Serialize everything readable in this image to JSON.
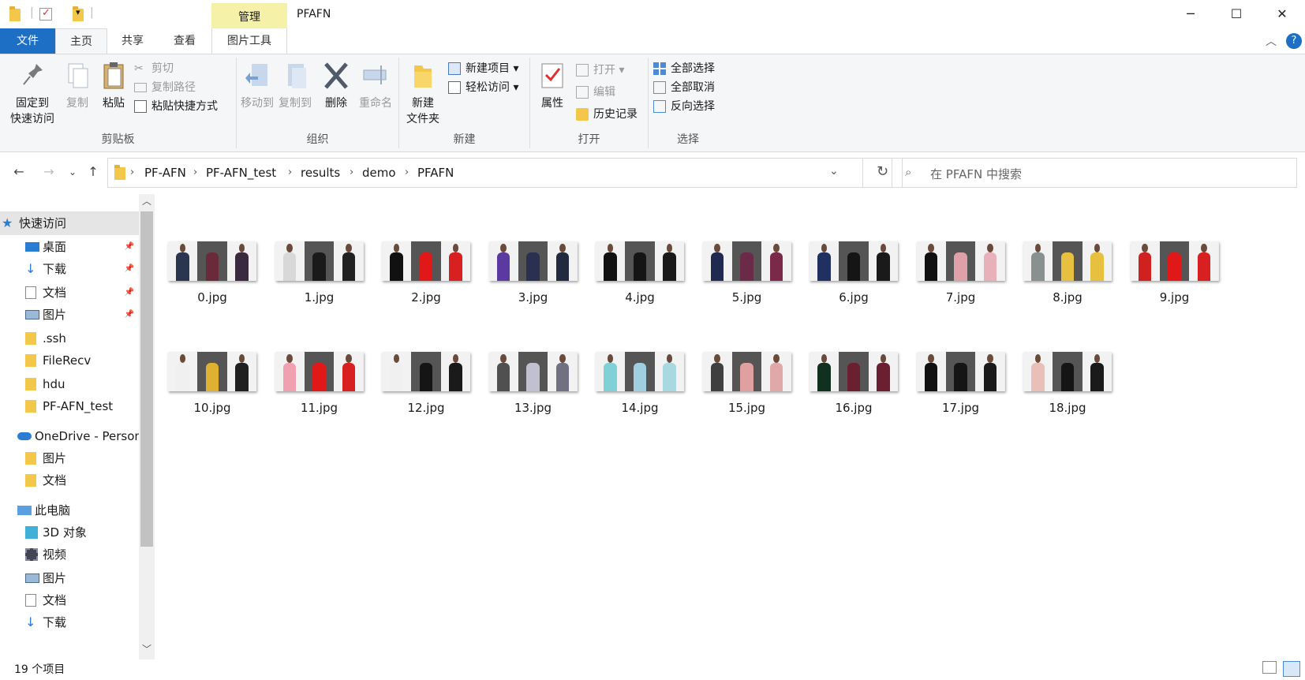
{
  "window": {
    "title": "PFAFN",
    "context_tab": "管理",
    "minimize": "─",
    "maximize": "☐",
    "close": "✕"
  },
  "ribbon_tabs": {
    "file": "文件",
    "home": "主页",
    "share": "共享",
    "view": "查看",
    "picture_tools": "图片工具"
  },
  "ribbon": {
    "clipboard": {
      "label": "剪贴板",
      "pin": "固定到\n快速访问",
      "pin_l1": "固定到",
      "pin_l2": "快速访问",
      "copy": "复制",
      "paste": "粘贴",
      "cut": "剪切",
      "copy_path": "复制路径",
      "paste_shortcut": "粘贴快捷方式"
    },
    "organize": {
      "label": "组织",
      "move_to": "移动到",
      "copy_to": "复制到",
      "delete": "删除",
      "rename": "重命名"
    },
    "new": {
      "label": "新建",
      "new_folder_l1": "新建",
      "new_folder_l2": "文件夹",
      "new_item": "新建项目",
      "easy_access": "轻松访问"
    },
    "open": {
      "label": "打开",
      "properties": "属性",
      "open": "打开",
      "edit": "编辑",
      "history": "历史记录"
    },
    "select": {
      "label": "选择",
      "select_all": "全部选择",
      "select_none": "全部取消",
      "invert": "反向选择"
    }
  },
  "address": {
    "crumbs": [
      "PF-AFN",
      "PF-AFN_test",
      "results",
      "demo",
      "PFAFN"
    ]
  },
  "search": {
    "placeholder": "在 PFAFN 中搜索"
  },
  "sidebar": [
    {
      "label": "快速访问",
      "icon": "star-icon",
      "pinned": false
    },
    {
      "label": "桌面",
      "icon": "desktop-icon",
      "pinned": true
    },
    {
      "label": "下载",
      "icon": "download-icon",
      "pinned": true
    },
    {
      "label": "文档",
      "icon": "document-icon",
      "pinned": true
    },
    {
      "label": "图片",
      "icon": "picture-icon",
      "pinned": true
    },
    {
      "label": ".ssh",
      "icon": "folder-icon",
      "pinned": false
    },
    {
      "label": "FileRecv",
      "icon": "folder-icon",
      "pinned": false
    },
    {
      "label": "hdu",
      "icon": "folder-icon",
      "pinned": false
    },
    {
      "label": "PF-AFN_test",
      "icon": "folder-icon",
      "pinned": false
    },
    {
      "label": "OneDrive - Personal",
      "icon": "cloud-icon",
      "pinned": false
    },
    {
      "label": "图片",
      "icon": "folder-icon",
      "pinned": false
    },
    {
      "label": "文档",
      "icon": "folder-icon",
      "pinned": false
    },
    {
      "label": "此电脑",
      "icon": "computer-icon",
      "pinned": false
    },
    {
      "label": "3D 对象",
      "icon": "cube-icon",
      "pinned": false
    },
    {
      "label": "视频",
      "icon": "video-icon",
      "pinned": false
    },
    {
      "label": "图片",
      "icon": "picture-icon",
      "pinned": false
    },
    {
      "label": "文档",
      "icon": "document-icon",
      "pinned": false
    },
    {
      "label": "下载",
      "icon": "download-icon",
      "pinned": false
    }
  ],
  "files": [
    {
      "name": "0.jpg",
      "colors": [
        "#2a3550",
        "#6a2a3a",
        "#3a2a40"
      ]
    },
    {
      "name": "1.jpg",
      "colors": [
        "#d8d8d8",
        "#1a1a1a",
        "#222222"
      ]
    },
    {
      "name": "2.jpg",
      "colors": [
        "#111111",
        "#e01818",
        "#d82020"
      ]
    },
    {
      "name": "3.jpg",
      "colors": [
        "#5a3aa0",
        "#2a3050",
        "#222a40"
      ]
    },
    {
      "name": "4.jpg",
      "colors": [
        "#111111",
        "#151515",
        "#1a1a1a"
      ]
    },
    {
      "name": "5.jpg",
      "colors": [
        "#202a50",
        "#6a2a48",
        "#7a2a48"
      ]
    },
    {
      "name": "6.jpg",
      "colors": [
        "#203060",
        "#151515",
        "#1a1a1a"
      ]
    },
    {
      "name": "7.jpg",
      "colors": [
        "#111111",
        "#e0a0a8",
        "#e8b0b8"
      ]
    },
    {
      "name": "8.jpg",
      "colors": [
        "#889090",
        "#e8c040",
        "#e8c040"
      ]
    },
    {
      "name": "9.jpg",
      "colors": [
        "#d02020",
        "#e01818",
        "#d82020"
      ]
    },
    {
      "name": "10.jpg",
      "colors": [
        "#f0f0f0",
        "#e0b030",
        "#202020"
      ]
    },
    {
      "name": "11.jpg",
      "colors": [
        "#f0a0b0",
        "#e01818",
        "#d82020"
      ]
    },
    {
      "name": "12.jpg",
      "colors": [
        "#f0f0f0",
        "#151515",
        "#1a1a1a"
      ]
    },
    {
      "name": "13.jpg",
      "colors": [
        "#505050",
        "#c0c0d0",
        "#707080"
      ]
    },
    {
      "name": "14.jpg",
      "colors": [
        "#80d0d8",
        "#a0d0e0",
        "#a8d8e0"
      ]
    },
    {
      "name": "15.jpg",
      "colors": [
        "#404040",
        "#e0a0a0",
        "#e0a8a8"
      ]
    },
    {
      "name": "16.jpg",
      "colors": [
        "#103020",
        "#6a2030",
        "#6a2030"
      ]
    },
    {
      "name": "17.jpg",
      "colors": [
        "#111111",
        "#151515",
        "#1a1a1a"
      ]
    },
    {
      "name": "18.jpg",
      "colors": [
        "#e8c0b8",
        "#151515",
        "#1a1a1a"
      ]
    }
  ],
  "status": {
    "count": "19 个项目"
  }
}
